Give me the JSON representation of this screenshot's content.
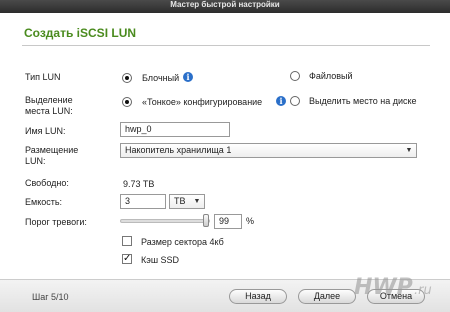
{
  "window": {
    "title": "Мастер быстрой настройки"
  },
  "section": {
    "title": "Создать iSCSI LUN"
  },
  "form": {
    "lun_type": {
      "label": "Тип LUN",
      "options": [
        {
          "label": "Блочный",
          "checked": true
        },
        {
          "label": "Файловый",
          "checked": false
        }
      ]
    },
    "allocation": {
      "label_line1": "Выделение",
      "label_line2": "места LUN:",
      "options": [
        {
          "label": "«Тонкое» конфигурирование",
          "checked": true
        },
        {
          "label": "Выделить место на диске",
          "checked": false
        }
      ]
    },
    "lun_name": {
      "label": "Имя LUN:",
      "value": "hwp_0"
    },
    "placement": {
      "label_line1": "Размещение",
      "label_line2": "LUN:",
      "value": "Накопитель хранилища 1"
    },
    "free": {
      "label": "Свободно:",
      "value": "9.73 TB"
    },
    "capacity": {
      "label": "Емкость:",
      "value": "3",
      "unit": "TB"
    },
    "alarm": {
      "label": "Порог тревоги:",
      "value": "99",
      "unit": "%",
      "level": 0.99
    },
    "sector_size": {
      "label": "Размер сектора 4кб",
      "checked": false
    },
    "ssd_cache": {
      "label": "Кэш SSD",
      "checked": true
    }
  },
  "footer": {
    "step": "Шаг 5/10",
    "back": "Назад",
    "next": "Далее",
    "cancel": "Отмена"
  },
  "watermark": {
    "text": "HWP.ru"
  },
  "icons": {
    "info": "info-icon",
    "dropdown": "chevron-down-icon",
    "check": "check-icon"
  },
  "colors": {
    "accent": "#4a8b1e",
    "info": "#2a6fc9"
  }
}
